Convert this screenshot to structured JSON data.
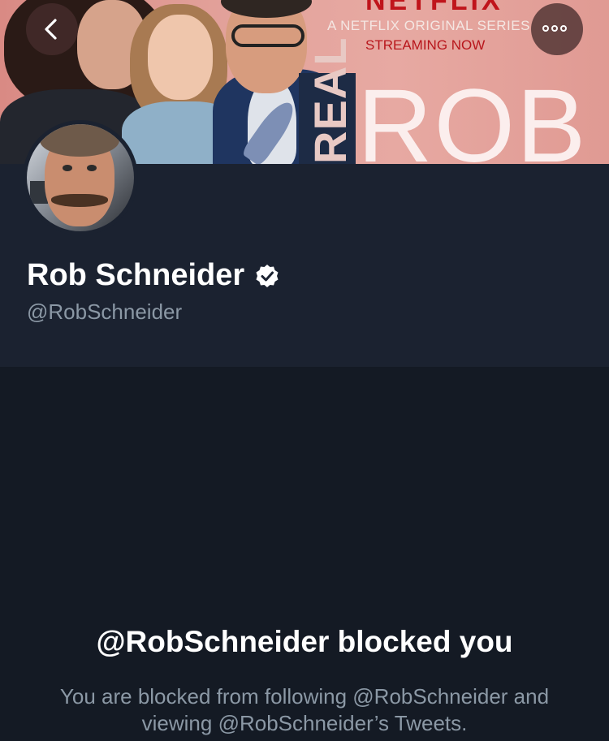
{
  "header": {
    "banner": {
      "brand": "NETFLIX",
      "tagline": "A NETFLIX ORIGINAL SERIES",
      "status": "STREAMING NOW",
      "show_word_vertical": "REAL",
      "show_word_large": "ROB"
    },
    "back_icon": "chevron-left-icon",
    "more_icon": "more-dots-icon"
  },
  "profile": {
    "display_name": "Rob Schneider",
    "handle": "@RobSchneider",
    "verified_icon": "verified-badge-icon"
  },
  "blocked": {
    "title": "@RobSchneider blocked you",
    "description": "You are blocked from following @RobSchneider and viewing @RobSchneider’s Tweets."
  },
  "colors": {
    "background": "#141a24",
    "profile_panel": "#1b2230",
    "text_primary": "#ffffff",
    "text_secondary": "#8b98a5",
    "netflix_red": "#c0141b"
  }
}
